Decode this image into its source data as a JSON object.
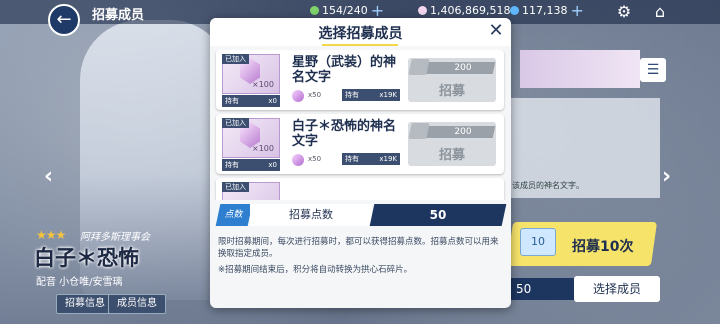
{
  "header": {
    "back_icon": "back-arrow-icon",
    "title": "招募成员",
    "stamina": "154/240",
    "gems": "1,406,869,518",
    "credits": "117,138",
    "settings_icon": "gear-icon",
    "home_icon": "home-icon"
  },
  "character": {
    "stars": "★★★",
    "club": "阿拜多斯理事会",
    "name": "白子＊恐怖",
    "cv": "配音 小仓唯/安雪璃",
    "tab_recruit_info": "招募信息",
    "tab_member_info": "成员信息"
  },
  "right": {
    "panel_text": "该成员的神名文字。",
    "recruit10_label": "招募10次",
    "points_value": "50",
    "select_member_label": "选择成员",
    "mail_badge": "10"
  },
  "modal": {
    "title": "选择招募成员",
    "close_icon": "close-icon",
    "cards": [
      {
        "joined": "已加入",
        "name": "星野（武装）的神名文字",
        "count": "×100",
        "owned_label": "持有",
        "owned_value": "x0",
        "need": "x50",
        "owned2_label": "持有",
        "owned2_value": "x19K",
        "cost": "200",
        "button": "招募"
      },
      {
        "joined": "已加入",
        "name": "白子＊恐怖的神名文字",
        "count": "×100",
        "owned_label": "持有",
        "owned_value": "x0",
        "need": "x50",
        "owned2_label": "持有",
        "owned2_value": "x19K",
        "cost": "200",
        "button": "招募"
      },
      {
        "joined": "已加入"
      }
    ],
    "points_badge": "点数",
    "points_label": "招募点数",
    "points_value": "50",
    "description": "限时招募期间，每次进行招募时，都可以获得招募点数。招募点数可以用来换取指定成员。",
    "note": "※招募期间结束后，积分将自动转换为拱心石碎片。"
  },
  "colors": {
    "accent_yellow": "#f1d54a",
    "navy": "#1c3660",
    "badge_blue": "#2f7fd0"
  }
}
